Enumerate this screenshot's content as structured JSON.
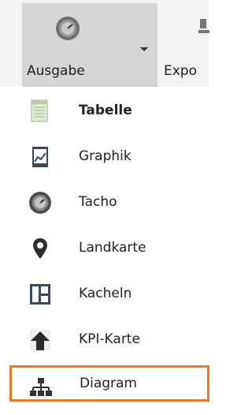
{
  "ribbon": {
    "output_label": "Ausgabe",
    "export_label": "Expo"
  },
  "menu": {
    "items": [
      {
        "label": "Tabelle",
        "icon": "table-icon"
      },
      {
        "label": "Graphik",
        "icon": "chart-icon"
      },
      {
        "label": "Tacho",
        "icon": "gauge-icon"
      },
      {
        "label": "Landkarte",
        "icon": "map-pin-icon"
      },
      {
        "label": "Kacheln",
        "icon": "tiles-icon"
      },
      {
        "label": "KPI-Karte",
        "icon": "kpi-arrow-icon"
      },
      {
        "label": "Diagram",
        "icon": "org-chart-icon"
      }
    ]
  },
  "colors": {
    "highlight": "#e8782c",
    "ribbon_selected": "#d5d5d5"
  }
}
